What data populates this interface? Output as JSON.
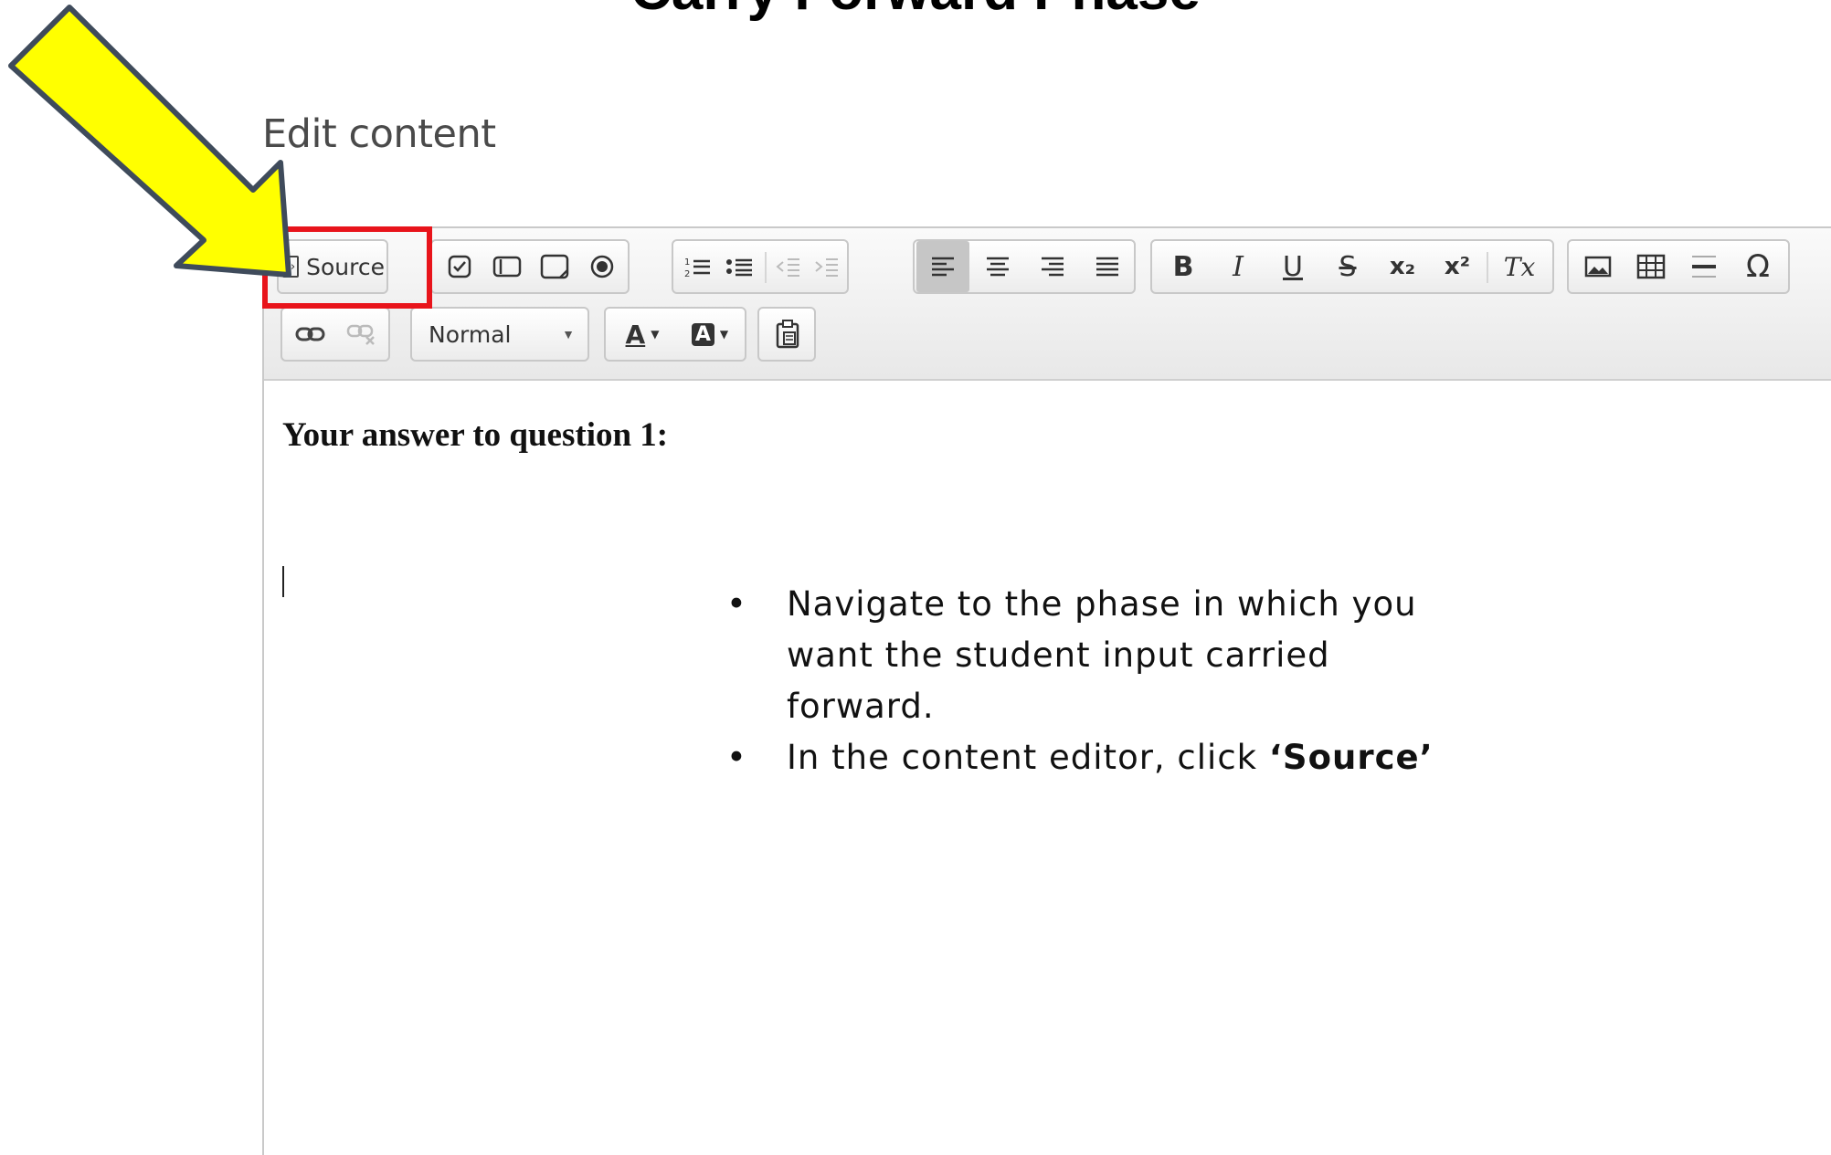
{
  "slide": {
    "title": "Carry Forward Phase"
  },
  "editor": {
    "heading": "Edit content",
    "toolbar": {
      "source_label": "Source",
      "source_icon": "source-icon",
      "format_combo": "Normal",
      "buttons": {
        "bold": "B",
        "italic": "I",
        "underline": "U",
        "strike": "S",
        "subscript": "x₂",
        "superscript": "x²",
        "remove_format": "Tx",
        "special_char": "Ω",
        "text_color": "A",
        "bg_color": "A"
      }
    },
    "content": {
      "heading": "Your answer to question 1:"
    }
  },
  "instructions": {
    "items": [
      {
        "text": "Navigate to the phase in which you want the student input carried forward."
      },
      {
        "text_before": "In the content editor, click ",
        "emphasis": "‘Source’"
      }
    ]
  },
  "annotation": {
    "arrow_color": "#ffff00",
    "arrow_outline": "#3f4b5b",
    "highlight_color": "#e8141b"
  }
}
